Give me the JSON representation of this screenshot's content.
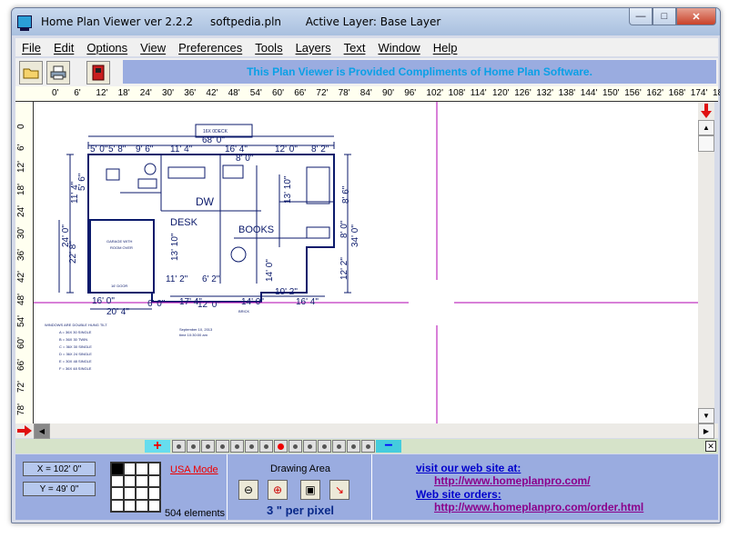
{
  "window": {
    "title": "Home Plan Viewer ver 2.2.2     softpedia.pln       Active Layer: Base Layer"
  },
  "menu": [
    "File",
    "Edit",
    "Options",
    "View",
    "Preferences",
    "Tools",
    "Layers",
    "Text",
    "Window",
    "Help"
  ],
  "toolbar": {
    "banner": "This Plan Viewer is Provided Compliments of Home Plan Software."
  },
  "hruler": [
    "0'",
    "6'",
    "12'",
    "18'",
    "24'",
    "30'",
    "36'",
    "42'",
    "48'",
    "54'",
    "60'",
    "66'",
    "72'",
    "78'",
    "84'",
    "90'",
    "96'",
    "102'",
    "108'",
    "114'",
    "120'",
    "126'",
    "132'",
    "138'",
    "144'",
    "150'",
    "156'",
    "162'",
    "168'",
    "174'",
    "18"
  ],
  "vruler": [
    "0",
    "6'",
    "12'",
    "18'",
    "24'",
    "30'",
    "36'",
    "42'",
    "48'",
    "54'",
    "60'",
    "66'",
    "72'",
    "78'",
    "84'"
  ],
  "plan": {
    "labels": {
      "top_note": "16X 0DECK",
      "dim_top": "68' 0\"",
      "d1": "5' 0\"",
      "d2": "5' 8\"",
      "d3": "9' 6\"",
      "d4": "11' 4\"",
      "d5": "16' 4\"",
      "d6": "8' 0\"",
      "d7": "12' 0\"",
      "d8": "8' 2\"",
      "dw": "DW",
      "desk": "DESK",
      "books": "BOOKS",
      "garage1": "GARAGE WITH",
      "garage2": "ROOM OVER",
      "v1": "11' 4\"",
      "v2": "5' 6\"",
      "v3": "24' 0\"",
      "v4": "22' 8\"",
      "v5": "13' 10\"",
      "v6": "13' 10\"",
      "v7": "14' 0\"",
      "v8": "8' 6\"",
      "v9": "12' 2\"",
      "v10": "34' 0\"",
      "v11": "8' 0\"",
      "b1": "11' 2\"",
      "b2": "6' 2\"",
      "b3": "10' 2\"",
      "b4": "17' 4\"",
      "b5": "14' 0\"",
      "b6": "16' 4\"",
      "b7": "20' 4\"",
      "b8": "16' 0\"",
      "b9": "6' 0\"",
      "b10": "12' 0\"",
      "door": "16' DOOR",
      "brick": "BRICK"
    },
    "windows_title": "WINDOWS ARE DOUBLE HUNG TILT",
    "windows_list": [
      "A = 36X 30 SINGLE",
      "B = 36X 30 TWIN",
      "C = 36X 30 SINGLE",
      "D = 36X 24 SINGLE",
      "E = 30X 48 SINGLE",
      "F = 36X 48 SINGLE"
    ],
    "date_note1": "September 10, 2013",
    "date_note2": "time 10:30:00 am"
  },
  "status": {
    "x": "X = 102' 0\"",
    "y": "Y = 49' 0\"",
    "usa_mode": "USA Mode",
    "elements": "504 elements",
    "drawing_area": "Drawing Area",
    "scale": "3 \" per pixel",
    "visit_title": "visit our web site at:",
    "visit_url": "http://www.homeplanpro.com/",
    "orders_title": "Web site orders:",
    "orders_url": "http://www.homeplanpro.com/order.html"
  },
  "colors": {
    "plan_line": "#0b1a6b",
    "cross": "#b000b0",
    "panel": "#9aace0",
    "banner_text": "#0aa0e6"
  }
}
